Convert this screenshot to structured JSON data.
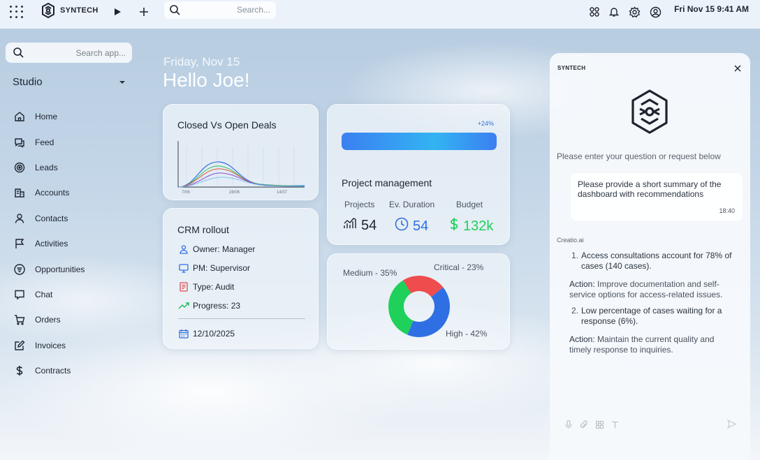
{
  "topbar": {
    "brand": "SYNTECH",
    "search_placeholder": "Search...",
    "datetime": "Fri Nov 15  9:41 AM"
  },
  "sidebar": {
    "search_placeholder": "Search app...",
    "workspace": "Studio",
    "items": [
      {
        "label": "Home",
        "icon": "home-icon"
      },
      {
        "label": "Feed",
        "icon": "feed-icon"
      },
      {
        "label": "Leads",
        "icon": "leads-icon"
      },
      {
        "label": "Accounts",
        "icon": "accounts-icon"
      },
      {
        "label": "Contacts",
        "icon": "contacts-icon"
      },
      {
        "label": "Activities",
        "icon": "flag-icon"
      },
      {
        "label": "Opportunities",
        "icon": "filter-icon"
      },
      {
        "label": "Chat",
        "icon": "chat-icon"
      },
      {
        "label": "Orders",
        "icon": "cart-icon"
      },
      {
        "label": "Invoices",
        "icon": "edit-icon"
      },
      {
        "label": "Contracts",
        "icon": "dollar-icon"
      }
    ]
  },
  "greeting": {
    "date": "Friday, Nov 15",
    "hello": "Hello Joe!"
  },
  "deals_card": {
    "title": "Closed Vs Open Deals",
    "ticks": [
      "7/06",
      "28/06",
      "14/07"
    ]
  },
  "crm_card": {
    "title": "CRM rollout",
    "owner_label": "Owner:",
    "owner_value": " Manager",
    "pm_label": "PM:",
    "pm_value": " Supervisor",
    "type_label": "Type:",
    "type_value": " Audit",
    "progress_label": "Progress:",
    "progress_value": " 23",
    "date": "12/10/2025"
  },
  "pm_card": {
    "change": "+24%",
    "progress_fraction": 1.0,
    "title": "Project management",
    "projects_label": "Projects",
    "duration_label": "Ev. Duration",
    "budget_label": "Budget",
    "projects_value": "54",
    "duration_value": "54",
    "budget_value": "132k"
  },
  "donut_card": {
    "medium_label": "Medium - 35%",
    "critical_label": "Critical - 23%",
    "high_label": "High - 42%",
    "segments": [
      {
        "name": "High",
        "percent": 42,
        "color": "#2f6fe4"
      },
      {
        "name": "Medium",
        "percent": 35,
        "color": "#1fd15a"
      },
      {
        "name": "Critical",
        "percent": 23,
        "color": "#ef4d4d"
      }
    ]
  },
  "assistant": {
    "brand": "SYNTECH",
    "prompt": "Please enter your question or request below",
    "user_message": "Please provide a short summary of the dashboard with recommendations",
    "user_time": "18:40",
    "bot_name": "Creatio.ai",
    "answer_1_num": "1.",
    "answer_1": "Access consultations account for 78% of cases (140 cases).",
    "action_1_label": "Action:",
    "action_1": " Improve documentation and self-service options for access-related issues.",
    "answer_2_num": "2.",
    "answer_2": "Low percentage of cases waiting for a response (6%).",
    "action_2_label": "Action:",
    "action_2": " Maintain the current quality and timely response to inquiries."
  },
  "colors": {
    "accent_blue": "#2f6fe4",
    "success_green": "#1fd15a",
    "danger_red": "#ef4d4d"
  }
}
